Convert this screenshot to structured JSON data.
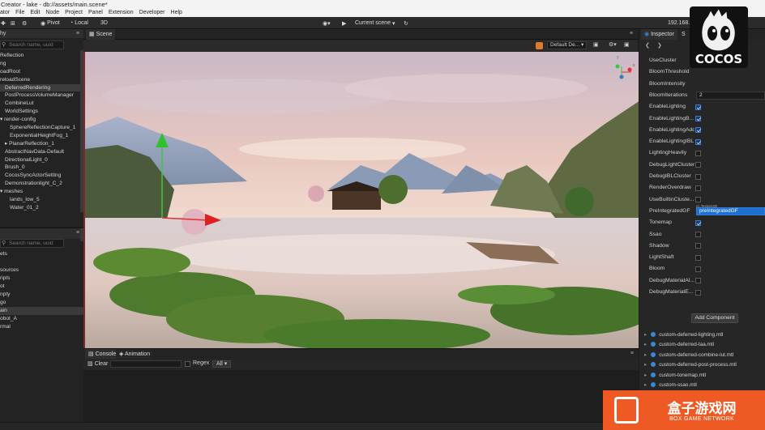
{
  "window": {
    "title": "Creator - lake - db://assets/main.scene*"
  },
  "menu": [
    "ator",
    "File",
    "Edit",
    "Node",
    "Project",
    "Panel",
    "Extension",
    "Developer",
    "Help"
  ],
  "toolbar": {
    "pivot_label": "Pivot",
    "local_label": "Local",
    "mode_label": "3D",
    "scene_select_label": "Current scene",
    "ip_text": "192.168."
  },
  "hierarchy": {
    "tab_label": "hy",
    "search_placeholder": "Search name, uuid",
    "items": [
      {
        "label": "Reflection",
        "indent": 0
      },
      {
        "label": "ng",
        "indent": 0
      },
      {
        "label": "oadRoot",
        "indent": 0
      },
      {
        "label": "reloadScene",
        "indent": 0
      },
      {
        "label": "DeferredRendering",
        "indent": 1,
        "selected": true
      },
      {
        "label": "PostProcessVolumeManager",
        "indent": 1
      },
      {
        "label": "CombineLut",
        "indent": 1
      },
      {
        "label": "WorldSettings",
        "indent": 1
      },
      {
        "label": "▾ render-config",
        "indent": 0
      },
      {
        "label": "SphereReflectionCapture_1",
        "indent": 2
      },
      {
        "label": "ExponentialHeightFog_1",
        "indent": 2
      },
      {
        "label": "▸ PlanarReflection_1",
        "indent": 1
      },
      {
        "label": "AbstractNavData-Default",
        "indent": 1
      },
      {
        "label": "DirectionalLight_0",
        "indent": 1
      },
      {
        "label": "Brush_0",
        "indent": 1
      },
      {
        "label": "CocosSyncActorSetting",
        "indent": 1
      },
      {
        "label": "Demonstrationlight_C_2",
        "indent": 1
      },
      {
        "label": "▾ meshes",
        "indent": 0
      },
      {
        "label": "lands_low_5",
        "indent": 2
      },
      {
        "label": "Water_01_2",
        "indent": 2
      }
    ]
  },
  "assets": {
    "search_placeholder": "Search name, uuid",
    "items": [
      {
        "label": "ets"
      },
      {
        "label": ""
      },
      {
        "label": "sources"
      },
      {
        "label": "ripts"
      },
      {
        "label": "ot"
      },
      {
        "label": "npty"
      },
      {
        "label": "go"
      },
      {
        "label": "ain",
        "selected": true
      },
      {
        "label": "obot_A"
      },
      {
        "label": "rmal"
      }
    ]
  },
  "scene": {
    "tab_label": "Scene",
    "camera_select": "Default De...",
    "gizmo_axes": {
      "x": "x",
      "y": "y",
      "z": "z"
    }
  },
  "console": {
    "tabs": [
      "Console",
      "Animation"
    ],
    "clear_label": "Clear",
    "regex_label": "Regex",
    "level_select": "All"
  },
  "inspector": {
    "tab_label": "Inspector",
    "tab2_label": "S",
    "properties": [
      {
        "name": "UseCluster",
        "type": "none"
      },
      {
        "name": "BloomThreshold",
        "type": "none"
      },
      {
        "name": "BloomIntensity",
        "type": "none"
      },
      {
        "name": "BloomIterations",
        "type": "number",
        "value": "2"
      },
      {
        "name": "EnableLighting",
        "type": "check",
        "checked": true
      },
      {
        "name": "EnableLightingB...",
        "type": "check",
        "checked": true
      },
      {
        "name": "EnableLightingAdd",
        "type": "check",
        "checked": true
      },
      {
        "name": "EnableLightingIBL",
        "type": "check",
        "checked": true
      },
      {
        "name": "LightingHeavily",
        "type": "check",
        "checked": false
      },
      {
        "name": "DebugLightCluster",
        "type": "check",
        "checked": false
      },
      {
        "name": "DebugIBLCluster",
        "type": "check",
        "checked": false
      },
      {
        "name": "RenderOverdraw",
        "type": "check",
        "checked": false
      },
      {
        "name": "UseBuiltinCluste...",
        "type": "check",
        "checked": false
      },
      {
        "name": "PreIntegratedGF",
        "type": "asset",
        "value": "preIntegratedGF",
        "caption": "cc.Texture2D"
      },
      {
        "name": "Tonemap",
        "type": "check",
        "checked": true
      },
      {
        "name": "Ssao",
        "type": "check",
        "checked": false
      },
      {
        "name": "Shadow",
        "type": "check",
        "checked": false
      },
      {
        "name": "LightShaft",
        "type": "check",
        "checked": false
      },
      {
        "name": "Bloom",
        "type": "check",
        "checked": false
      },
      {
        "name": "DebugMaterialAl...",
        "type": "check",
        "checked": false
      },
      {
        "name": "DebugMaterialE...",
        "type": "check",
        "checked": false
      }
    ],
    "add_component_label": "Add Component",
    "materials": [
      "custom-deferred-lighting.mtl",
      "custom-deferred-taa.mtl",
      "custom-deferred-combine-lut.mtl",
      "custom-deferred-post-process.mtl",
      "custom-tonemap.mtl",
      "custom-ssao.mtl"
    ]
  },
  "overlays": {
    "brand_text": "COCOS",
    "watermark_title": "盒子游戏网",
    "watermark_sub": "BOX GAME NETWORK"
  },
  "colors": {
    "accent_blue": "#1f6fd1",
    "viewport_border": "#7e2828",
    "watermark_orange": "#ef5a24"
  }
}
